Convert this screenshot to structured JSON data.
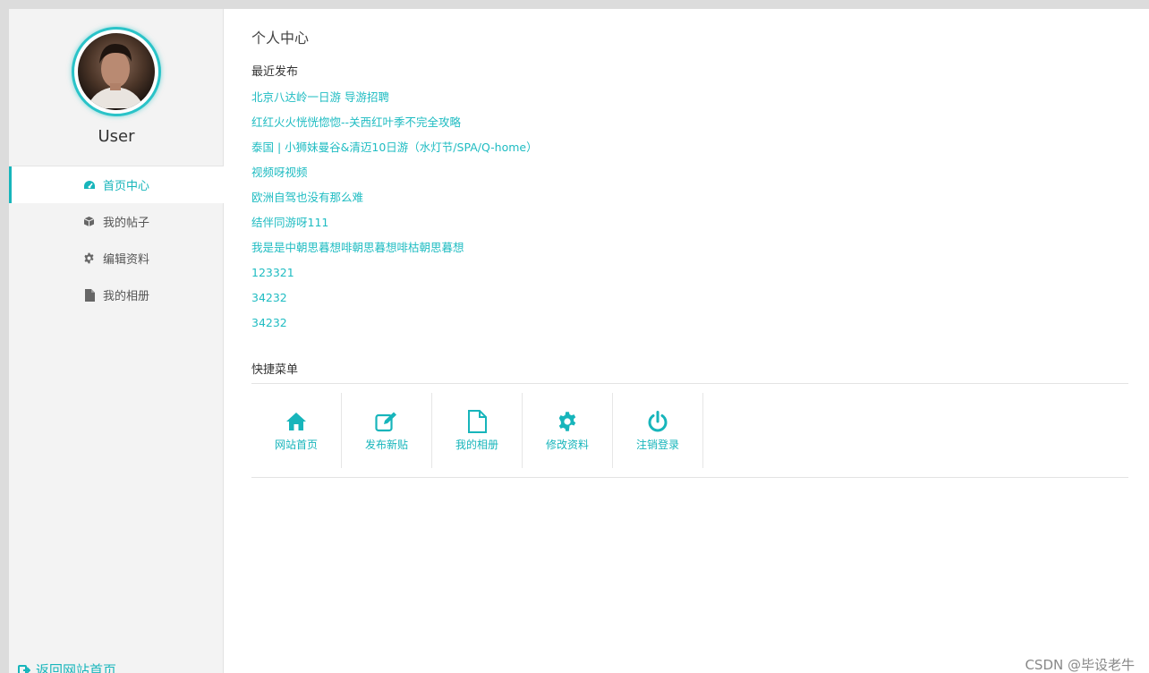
{
  "sidebar": {
    "username": "User",
    "avatar_icon": "user-portrait",
    "nav": [
      {
        "label": "首页中心",
        "icon": "dashboard-icon",
        "active": true
      },
      {
        "label": "我的帖子",
        "icon": "cube-icon",
        "active": false
      },
      {
        "label": "编辑资料",
        "icon": "gear-icon",
        "active": false
      },
      {
        "label": "我的相册",
        "icon": "file-icon",
        "active": false
      }
    ],
    "back_label": "返回网站首页"
  },
  "main": {
    "title": "个人中心",
    "recent_title": "最近发布",
    "posts": [
      "北京八达岭一日游 导游招聘",
      "红红火火恍恍惚惚--关西红叶季不完全攻略",
      "泰国 | 小狮妹曼谷&清迈10日游（水灯节/SPA/Q-home）",
      "视频呀视频",
      "欧洲自驾也没有那么难",
      "结伴同游呀111",
      "我是是中朝思暮想啡朝思暮想啡枯朝思暮想",
      "123321",
      "34232",
      "34232"
    ],
    "quick_title": "快捷菜单",
    "quick": [
      {
        "label": "网站首页",
        "icon": "home-icon"
      },
      {
        "label": "发布新贴",
        "icon": "edit-icon"
      },
      {
        "label": "我的相册",
        "icon": "file-icon"
      },
      {
        "label": "修改资料",
        "icon": "gear-icon"
      },
      {
        "label": "注销登录",
        "icon": "power-icon"
      }
    ]
  },
  "watermark": "CSDN @毕设老牛",
  "colors": {
    "accent": "#17b5bb",
    "sidebar_bg": "#f3f3f3",
    "link": "#1fbcc2"
  }
}
